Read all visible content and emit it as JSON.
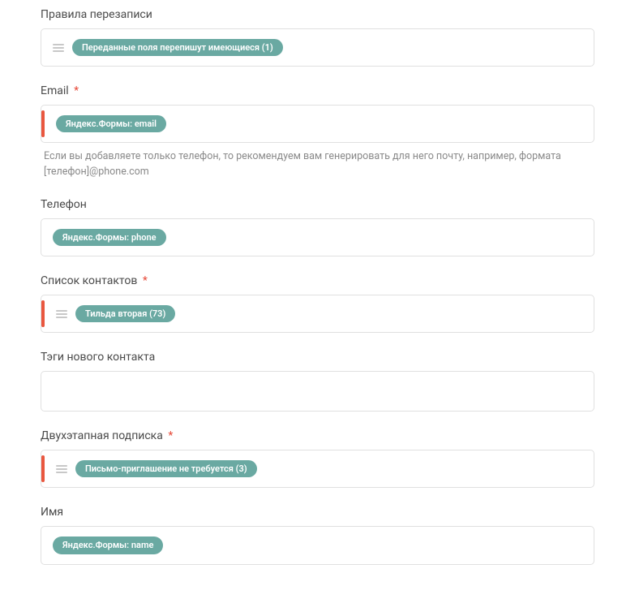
{
  "fields": {
    "rewrite_rules": {
      "label": "Правила перезаписи",
      "required": false,
      "marker": false,
      "has_list_icon": true,
      "chip": "Переданные поля перепишут имеющиеся (1)"
    },
    "email": {
      "label": "Email",
      "required": true,
      "marker": true,
      "has_list_icon": false,
      "chip": "Яндекс.Формы: email",
      "hint": "Если вы добавляете только телефон, то рекомендуем вам генерировать для него почту, например, формата [телефон]@phone.com"
    },
    "phone": {
      "label": "Телефон",
      "required": false,
      "marker": false,
      "has_list_icon": false,
      "chip": "Яндекс.Формы: phone"
    },
    "contact_list": {
      "label": "Список контактов",
      "required": true,
      "marker": true,
      "has_list_icon": true,
      "chip": "Тильда вторая (73)"
    },
    "new_contact_tags": {
      "label": "Тэги нового контакта",
      "required": false,
      "marker": false,
      "empty": true
    },
    "two_step": {
      "label": "Двухэтапная подписка",
      "required": true,
      "marker": true,
      "has_list_icon": true,
      "chip": "Письмо-приглашение не требуется (3)"
    },
    "name": {
      "label": "Имя",
      "required": false,
      "marker": false,
      "has_list_icon": false,
      "chip": "Яндекс.Формы: name"
    }
  },
  "required_symbol": "*"
}
